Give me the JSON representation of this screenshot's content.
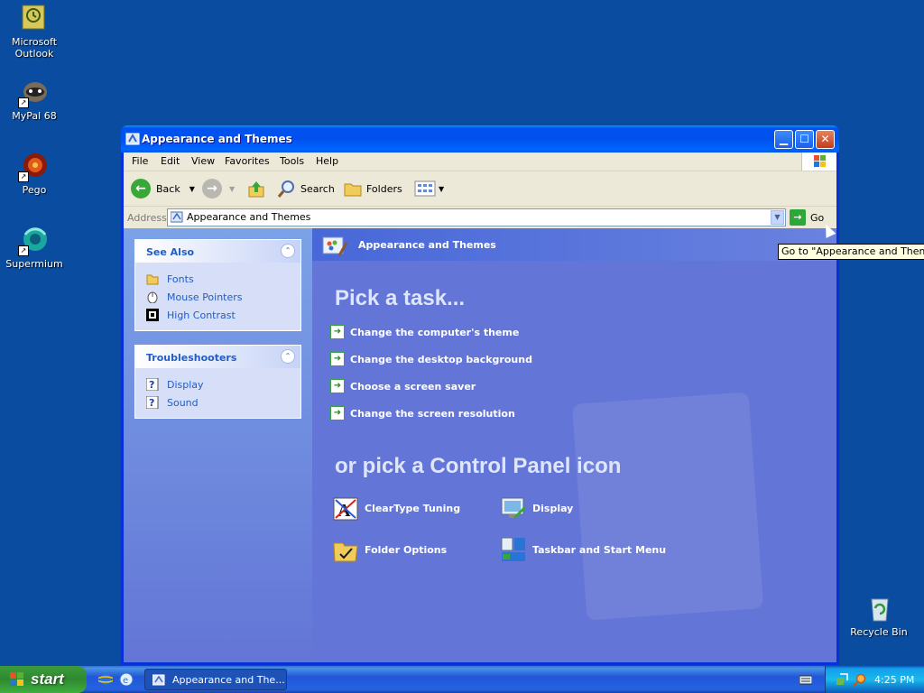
{
  "desktop": {
    "icons": [
      {
        "label_line1": "Microsoft",
        "label_line2": "Outlook"
      },
      {
        "label_line1": "MyPal 68",
        "label_line2": ""
      },
      {
        "label_line1": "Pego",
        "label_line2": ""
      },
      {
        "label_line1": "Supermium",
        "label_line2": ""
      },
      {
        "label_line1": "Recycle Bin",
        "label_line2": ""
      }
    ]
  },
  "window": {
    "title": "Appearance and Themes",
    "menu": [
      "File",
      "Edit",
      "View",
      "Favorites",
      "Tools",
      "Help"
    ],
    "toolbar": {
      "back_label": "Back",
      "search_label": "Search",
      "folders_label": "Folders"
    },
    "address": {
      "label": "Address",
      "value": "Appearance and Themes",
      "go_label": "Go"
    },
    "see_also": {
      "title": "See Also",
      "items": [
        "Fonts",
        "Mouse Pointers",
        "High Contrast"
      ]
    },
    "troubleshooters": {
      "title": "Troubleshooters",
      "items": [
        "Display",
        "Sound"
      ]
    },
    "content": {
      "header": "Appearance and Themes",
      "pick_task": "Pick a task...",
      "tasks": [
        "Change the computer's theme",
        "Change the desktop background",
        "Choose a screen saver",
        "Change the screen resolution"
      ],
      "pick_icon": "or pick a Control Panel icon",
      "icons": [
        "ClearType Tuning",
        "Display",
        "Folder Options",
        "Taskbar and Start Menu"
      ]
    }
  },
  "tooltip": "Go to \"Appearance and Themes\"",
  "taskbar": {
    "start_label": "start",
    "task_button": "Appearance and The...",
    "clock": "4:25 PM"
  },
  "colors": {
    "desktop": "#0a4da0",
    "title_blue": "#0053ee",
    "task_pane": "#7ba2e7",
    "content": "#6375d6",
    "link": "#215dc6",
    "start_green": "#3c9a3c"
  }
}
